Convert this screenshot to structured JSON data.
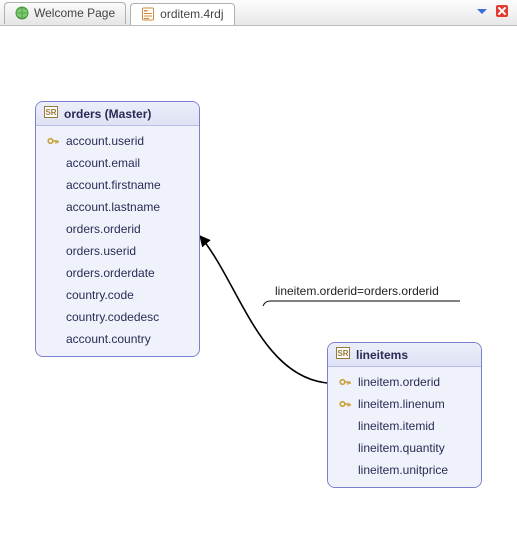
{
  "tabs": {
    "welcome": {
      "label": "Welcome Page"
    },
    "active": {
      "label": "orditem.4rdj"
    }
  },
  "entities": {
    "orders": {
      "title": "orders (Master)",
      "fields": [
        {
          "label": "account.userid",
          "key": true
        },
        {
          "label": "account.email",
          "key": false
        },
        {
          "label": "account.firstname",
          "key": false
        },
        {
          "label": "account.lastname",
          "key": false
        },
        {
          "label": "orders.orderid",
          "key": false
        },
        {
          "label": "orders.userid",
          "key": false
        },
        {
          "label": "orders.orderdate",
          "key": false
        },
        {
          "label": "country.code",
          "key": false
        },
        {
          "label": "country.codedesc",
          "key": false
        },
        {
          "label": "account.country",
          "key": false
        }
      ]
    },
    "lineitems": {
      "title": "lineitems",
      "fields": [
        {
          "label": "lineitem.orderid",
          "key": true
        },
        {
          "label": "lineitem.linenum",
          "key": true
        },
        {
          "label": "lineitem.itemid",
          "key": false
        },
        {
          "label": "lineitem.quantity",
          "key": false
        },
        {
          "label": "lineitem.unitprice",
          "key": false
        }
      ]
    }
  },
  "relationship": {
    "label": "lineitem.orderid=orders.orderid"
  },
  "icons": {
    "sr": "SR"
  }
}
